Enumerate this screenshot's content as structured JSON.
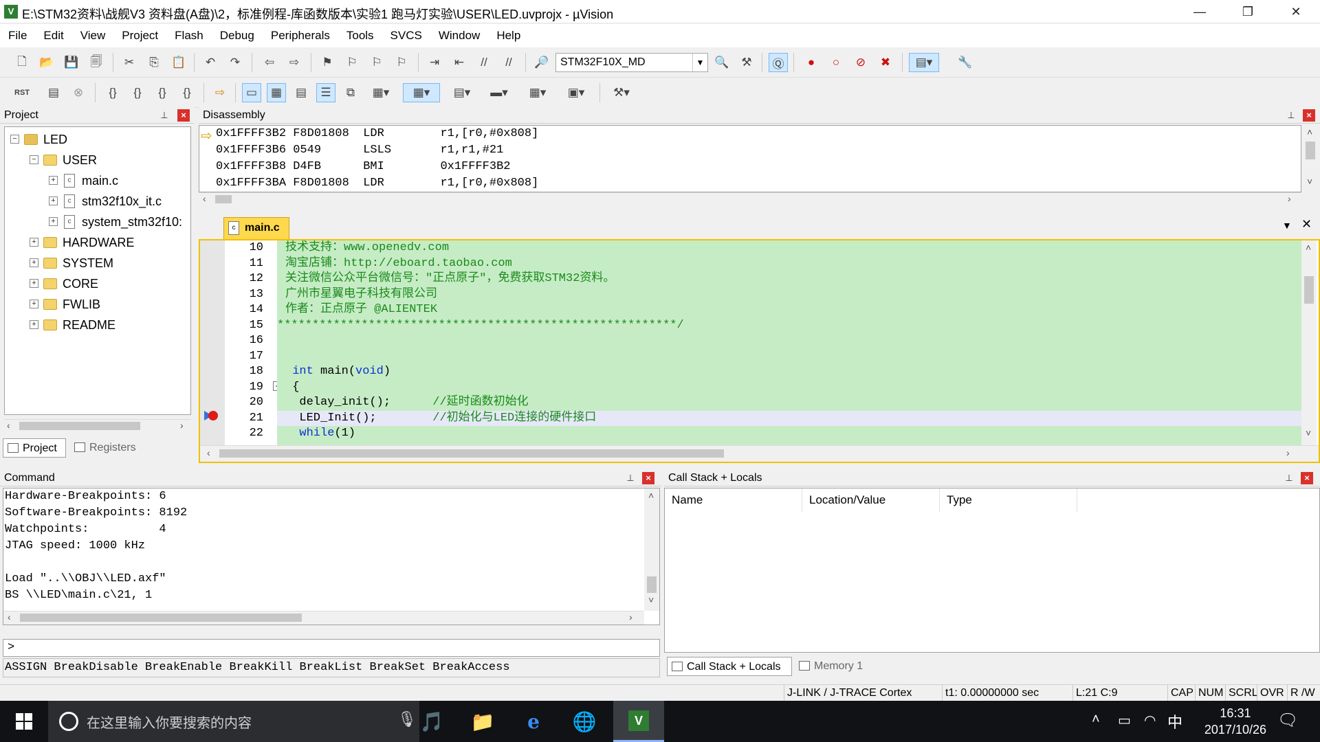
{
  "window": {
    "app_icon": "V",
    "title": "E:\\STM32资料\\战舰V3 资料盘(A盘)\\2，标准例程-库函数版本\\实验1 跑马灯实验\\USER\\LED.uvprojx - µVision",
    "minimize": "—",
    "restore": "❐",
    "close": "✕"
  },
  "menu": [
    "File",
    "Edit",
    "View",
    "Project",
    "Flash",
    "Debug",
    "Peripherals",
    "Tools",
    "SVCS",
    "Window",
    "Help"
  ],
  "toolbar": {
    "target": "STM32F10X_MD",
    "rst_label": "RST"
  },
  "project_panel": {
    "title": "Project",
    "tree": [
      {
        "label": "LED",
        "level": 0,
        "type": "root",
        "exp": "−"
      },
      {
        "label": "USER",
        "level": 1,
        "type": "folder",
        "exp": "−"
      },
      {
        "label": "main.c",
        "level": 2,
        "type": "file",
        "exp": "+"
      },
      {
        "label": "stm32f10x_it.c",
        "level": 2,
        "type": "file",
        "exp": "+"
      },
      {
        "label": "system_stm32f10:",
        "level": 2,
        "type": "file",
        "exp": "+"
      },
      {
        "label": "HARDWARE",
        "level": 1,
        "type": "folder",
        "exp": "+"
      },
      {
        "label": "SYSTEM",
        "level": 1,
        "type": "folder",
        "exp": "+"
      },
      {
        "label": "CORE",
        "level": 1,
        "type": "folder",
        "exp": "+"
      },
      {
        "label": "FWLIB",
        "level": 1,
        "type": "folder",
        "exp": "+"
      },
      {
        "label": "README",
        "level": 1,
        "type": "folder",
        "exp": "+"
      }
    ],
    "tabs": [
      "Project",
      "Registers"
    ]
  },
  "disassembly": {
    "title": "Disassembly",
    "rows": [
      "0x1FFFF3B2 F8D01808  LDR        r1,[r0,#0x808]",
      "0x1FFFF3B6 0549      LSLS       r1,r1,#21",
      "0x1FFFF3B8 D4FB      BMI        0x1FFFF3B2",
      "0x1FFFF3BA F8D01808  LDR        r1,[r0,#0x808]"
    ]
  },
  "editor": {
    "tab": "main.c",
    "lines": [
      {
        "n": "10",
        "text": "技术支持：www.openedv.com",
        "cls": "cmt"
      },
      {
        "n": "11",
        "text": "淘宝店铺：http://eboard.taobao.com",
        "cls": "cmt"
      },
      {
        "n": "12",
        "text": "关注微信公众平台微信号：\"正点原子\"，免费获取STM32资料。",
        "cls": "cmt"
      },
      {
        "n": "13",
        "text": "广州市星翼电子科技有限公司",
        "cls": "cmt"
      },
      {
        "n": "14",
        "text": "作者：正点原子 @ALIENTEK",
        "cls": "cmt"
      },
      {
        "n": "15",
        "text": "*********************************************************/",
        "cls": "cmt"
      },
      {
        "n": "16",
        "text": "",
        "cls": ""
      },
      {
        "n": "17",
        "text": "",
        "cls": ""
      },
      {
        "n": "18",
        "text": " int main(void)",
        "cls": "kwline"
      },
      {
        "n": "19",
        "text": " {",
        "cls": ""
      },
      {
        "n": "20",
        "text": "  delay_init();      //延时函数初始化",
        "cls": "mix"
      },
      {
        "n": "21",
        "text": "  LED_Init();        //初始化与LED连接的硬件接口",
        "cls": "mix"
      },
      {
        "n": "22",
        "text": "  while(1)",
        "cls": "kw"
      }
    ]
  },
  "command": {
    "title": "Command",
    "lines": [
      "Hardware-Breakpoints: 6",
      "Software-Breakpoints: 8192",
      "Watchpoints:          4",
      "JTAG speed: 1000 kHz",
      "",
      "Load \"..\\\\OBJ\\\\LED.axf\"",
      "BS \\\\LED\\main.c\\21, 1"
    ],
    "prompt": ">",
    "hint": "ASSIGN BreakDisable BreakEnable BreakKill BreakList BreakSet BreakAccess"
  },
  "callstack": {
    "title": "Call Stack + Locals",
    "columns": [
      "Name",
      "Location/Value",
      "Type"
    ],
    "tabs": [
      "Call Stack + Locals",
      "Memory 1"
    ]
  },
  "status": {
    "debugger": "J-LINK / J-TRACE Cortex",
    "time": "t1: 0.00000000 sec",
    "pos": "L:21 C:9",
    "caps": "CAP",
    "num": "NUM",
    "scrl": "SCRL",
    "ovr": "OVR",
    "rw": "R /W"
  },
  "taskbar": {
    "search_placeholder": "在这里输入你要搜索的内容",
    "ime": "中",
    "time": "16:31",
    "date": "2017/10/26"
  },
  "colors": {
    "editor_bg": "#c6ecc6",
    "comment": "#1a8a1a",
    "keyword": "#1030d0",
    "tab_active": "#ffd94d",
    "close_red": "#d9302c"
  }
}
